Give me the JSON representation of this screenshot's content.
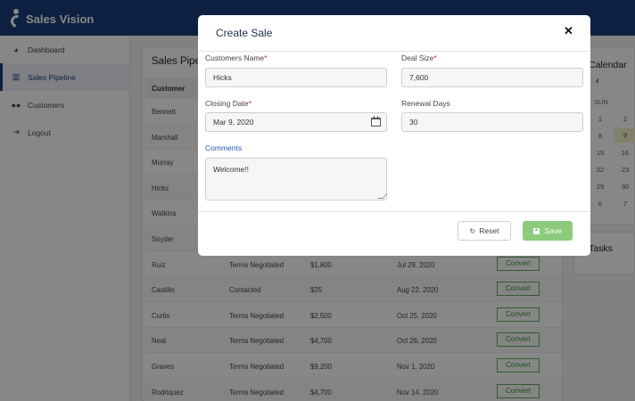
{
  "app": {
    "name": "Sales Vision"
  },
  "sidebar": {
    "items": [
      {
        "label": "Dashboard",
        "icon": "dashboard-icon"
      },
      {
        "label": "Sales Pipeline",
        "icon": "chart-icon",
        "active": true
      },
      {
        "label": "Customers",
        "icon": "users-icon"
      },
      {
        "label": "Logout",
        "icon": "logout-icon"
      }
    ]
  },
  "pipeline": {
    "title": "Sales Pipe",
    "columns": [
      "Customer"
    ],
    "convert_label": "Convert",
    "rows": [
      {
        "customer": "Bennett",
        "status": "",
        "amount": "",
        "date": ""
      },
      {
        "customer": "Marshall",
        "status": "",
        "amount": "",
        "date": ""
      },
      {
        "customer": "Murray",
        "status": "",
        "amount": "",
        "date": ""
      },
      {
        "customer": "Hicks",
        "status": "",
        "amount": "",
        "date": ""
      },
      {
        "customer": "Watkins",
        "status": "",
        "amount": "",
        "date": ""
      },
      {
        "customer": "Snyder",
        "status": "",
        "amount": "",
        "date": ""
      },
      {
        "customer": "Ruiz",
        "status": "Terms Negotiated",
        "amount": "$1,800",
        "date": "Jul 29, 2020"
      },
      {
        "customer": "Castillo",
        "status": "Contacted",
        "amount": "$25",
        "date": "Aug 22, 2020"
      },
      {
        "customer": "Curtis",
        "status": "Terms Negotiated",
        "amount": "$2,500",
        "date": "Oct 25, 2020"
      },
      {
        "customer": "Neal",
        "status": "Terms Negotiated",
        "amount": "$4,700",
        "date": "Oct 26, 2020"
      },
      {
        "customer": "Graves",
        "status": "Terms Negotiated",
        "amount": "$9,200",
        "date": "Nov 1, 2020"
      },
      {
        "customer": "Rodriquez",
        "status": "Terms Negotiated",
        "amount": "$4,700",
        "date": "Nov 14, 2020"
      }
    ]
  },
  "calendar": {
    "title": "Calendar",
    "weekday": "SUN",
    "days": [
      "1",
      "8",
      "15",
      "22",
      "29",
      "6"
    ],
    "days_right": [
      "2",
      "9",
      "16",
      "23",
      "30",
      "7"
    ]
  },
  "tasks": {
    "title": "Tasks"
  },
  "modal": {
    "title": "Create Sale",
    "close": "✕",
    "customers_name_label": "Customers Name",
    "customers_name_value": "Hicks",
    "deal_size_label": "Deal Size",
    "deal_size_value": "7,600",
    "closing_date_label": "Closing Date",
    "closing_date_value": "Mar 9, 2020",
    "renewal_days_label": "Renewal Days",
    "renewal_days_value": "30",
    "comments_label": "Comments",
    "comments_value": "Welcome!!",
    "required_mark": "*",
    "reset_label": "Reset",
    "save_label": "Save"
  },
  "colors": {
    "topbar": "#1a3d7c",
    "save": "#8ccb7b",
    "convert": "#3d9a3a"
  }
}
